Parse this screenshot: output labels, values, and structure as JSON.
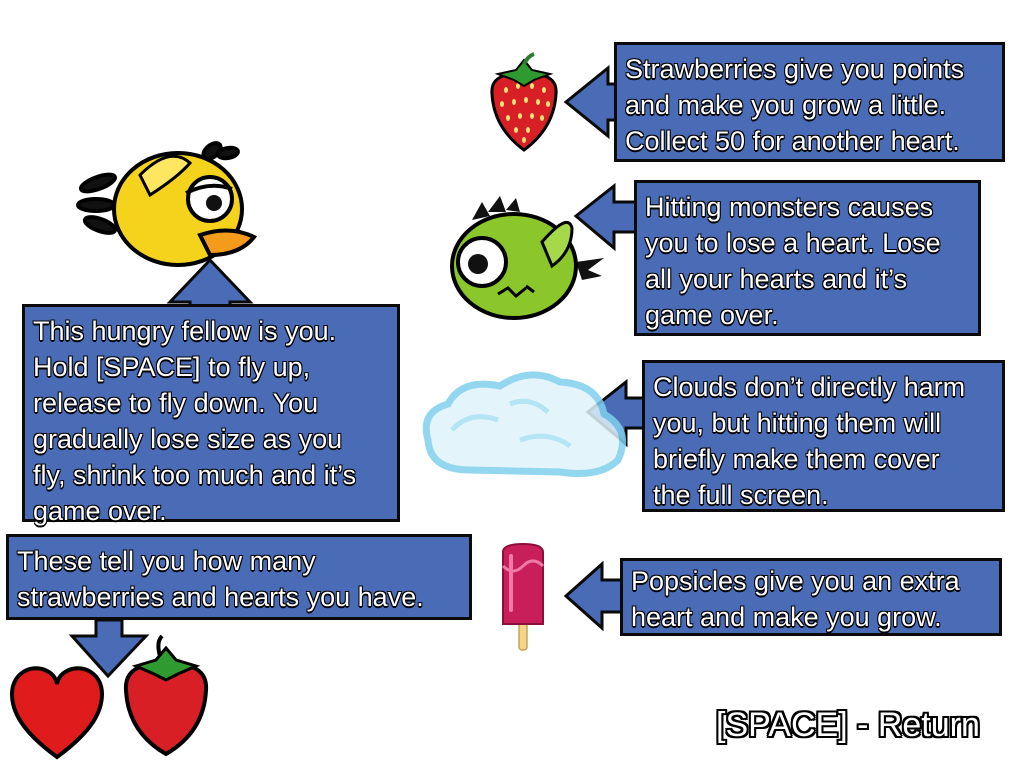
{
  "tips": {
    "player": {
      "lines": [
        "This hungry fellow is you.",
        "Hold [SPACE] to fly up,",
        "release to fly down. You",
        "gradually lose size as you",
        "fly, shrink too much and it’s",
        "game over."
      ]
    },
    "strawberry": {
      "lines": [
        "Strawberries give you points",
        "and make you grow a little.",
        "Collect 50 for another heart."
      ]
    },
    "monster": {
      "lines": [
        "Hitting monsters causes",
        "you to lose a heart. Lose",
        "all your hearts and it’s",
        "game over."
      ]
    },
    "cloud": {
      "lines": [
        "Clouds don’t directly harm",
        "you, but hitting them will",
        "briefly make them cover",
        "the full screen."
      ]
    },
    "counters": {
      "lines": [
        "These tell you how many",
        "strawberries and hearts you have."
      ]
    },
    "popsicle": {
      "lines": [
        "Popsicles give you an extra",
        "heart and make you grow."
      ]
    }
  },
  "footer": {
    "return_label": "[SPACE] - Return"
  },
  "colors": {
    "box_fill": "#4a6bb5",
    "box_border": "#0a0a0a",
    "bird_yellow": "#f5d31c",
    "monster_green": "#8bc62a",
    "strawberry_red": "#d81f26",
    "heart_red": "#e01b1b",
    "popsicle_pink": "#c81e5a",
    "cloud_blue": "#7fd0ee"
  },
  "icons": [
    "yellow-bird-icon",
    "strawberry-icon",
    "green-monster-icon",
    "cloud-icon",
    "popsicle-icon",
    "heart-icon",
    "strawberry-counter-icon"
  ]
}
